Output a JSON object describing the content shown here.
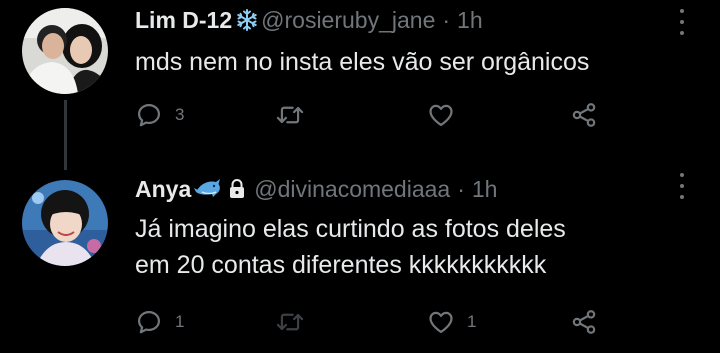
{
  "thread": {
    "parent": {
      "author_name": "Lim D-12",
      "badge_icon": "snowflake-icon",
      "handle": "@rosieruby_jane",
      "separator": "·",
      "time": "1h",
      "text_lines": [
        "mds nem no insta eles vão ser orgânicos"
      ],
      "actions": {
        "replies": "3",
        "retweets": "",
        "likes": ""
      }
    },
    "reply": {
      "author_name": "Anya",
      "badge_icon": "dolphin-icon",
      "protected_icon": "lock-icon",
      "handle": "@divinacomediaaa",
      "separator": "·",
      "time": "1h",
      "text_lines": [
        "Já imagino elas curtindo as fotos deles",
        "em 20 contas diferentes kkkkkkkkkkk"
      ],
      "actions": {
        "replies": "1",
        "retweets": "",
        "likes": "1"
      }
    }
  },
  "colors": {
    "background": "#000000",
    "primary_text": "#e7e9ea",
    "secondary_text": "#71767b",
    "thread_line": "#333639",
    "snowflake": "#8ecdf3",
    "dolphin": "#59a8e3"
  }
}
